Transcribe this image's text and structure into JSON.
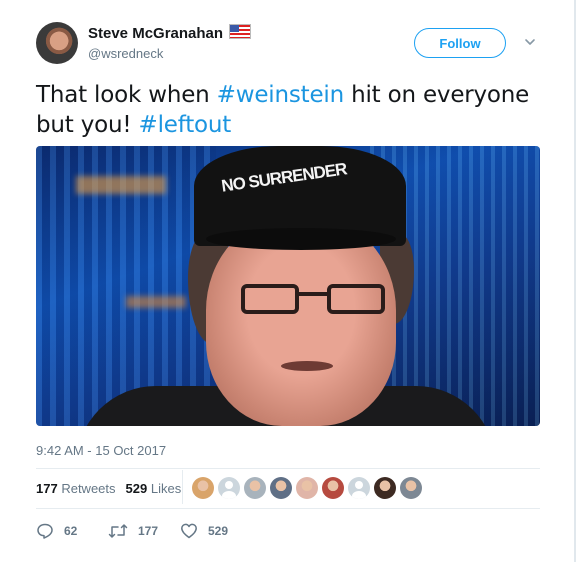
{
  "author": {
    "name": "Steve McGranahan",
    "handle": "@wsredneck"
  },
  "follow_label": "Follow",
  "tweet": {
    "text_1": "That look when ",
    "hashtag_1": "#weinstein",
    "text_2": " hit on everyone but you! ",
    "hashtag_2": "#leftout"
  },
  "photo": {
    "cap_text": "NO SURRENDER"
  },
  "timestamp": "9:42 AM - 15 Oct 2017",
  "stats": {
    "retweets_count": "177",
    "retweets_label": "Retweets",
    "likes_count": "529",
    "likes_label": "Likes"
  },
  "likers": [
    {
      "color": "#d9a46a"
    },
    {
      "color": "default"
    },
    {
      "color": "#a8b3bc"
    },
    {
      "color": "#5f6f86"
    },
    {
      "color": "#e0b5a8"
    },
    {
      "color": "#b64a3f"
    },
    {
      "color": "default"
    },
    {
      "color": "#3d2a22"
    },
    {
      "color": "#7d8894"
    }
  ],
  "actions": {
    "reply_count": "62",
    "retweet_count": "177",
    "like_count": "529"
  },
  "colors": {
    "accent": "#1da1f2",
    "hashtag": "#1b95e0",
    "muted": "#657786"
  }
}
